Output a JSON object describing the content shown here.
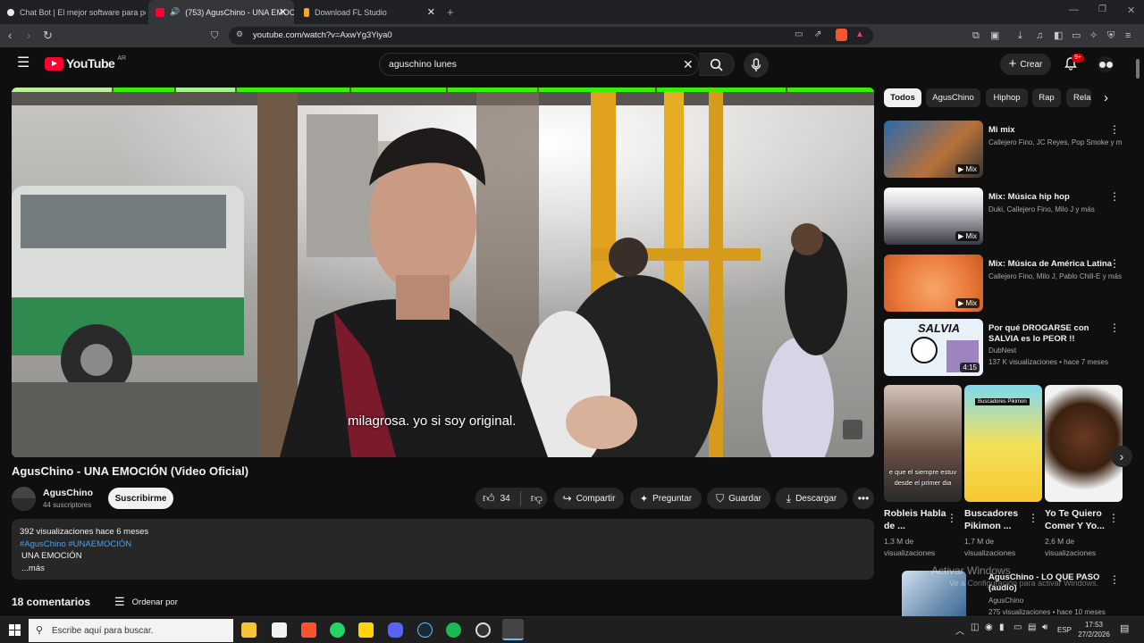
{
  "browser": {
    "tabs": [
      {
        "title": "Chat Bot | El mejor software para pol"
      },
      {
        "title": "(753) AgusChino - UNA EMOC"
      },
      {
        "title": "Download FL Studio"
      }
    ],
    "url": "youtube.com/watch?v=AxwYg3Yiya0"
  },
  "youtube": {
    "logo": "YouTube",
    "country": "AR",
    "search_value": "aguschino lunes",
    "create_label": "Crear",
    "notification_count": "9+"
  },
  "video": {
    "caption": "milagrosa.  yo si soy original.",
    "title": "AgusChino - UNA EMOCIÓN (Video Oficial)",
    "channel": "AgusChino",
    "subscribers": "44 suscriptores",
    "subscribe_label": "Suscribirme",
    "likes": "34",
    "share_label": "Compartir",
    "ask_label": "Preguntar",
    "save_label": "Guardar",
    "download_label": "Descargar",
    "progress_segments_color": "#35f000"
  },
  "description": {
    "stats": "392 visualizaciones  hace 6 meses",
    "hashtags": "#AgusChino  #UNAEMOCIÓN",
    "line1": "UNA EMOCIÓN",
    "more": "...más"
  },
  "comments": {
    "count_label": "18 comentarios",
    "sort_label": "Ordenar por"
  },
  "chips": [
    "Todos",
    "AgusChino",
    "Hiphop",
    "Rap",
    "Rela"
  ],
  "recommendations": [
    {
      "title": "Mi mix",
      "sub1": "Callejero Fino, JC Reyes, Pop Smoke y m...",
      "sub2": "",
      "badge": "Mix"
    },
    {
      "title": "Mix: Música hip hop",
      "sub1": "Duki, Callejero Fino, Milo J y más",
      "sub2": "",
      "badge": "Mix"
    },
    {
      "title": "Mix: Música de América Latina",
      "sub1": "Callejero Fino, Milo J, Pablo Chill-E y más",
      "sub2": "",
      "badge": "Mix"
    },
    {
      "title": "Por qué DROGARSE con SALVIA es lo PEOR !!",
      "sub1": "DubNest",
      "sub2": "137 K visualizaciones  •  hace 7 meses",
      "badge": "4:15"
    }
  ],
  "shorts": [
    {
      "title": "Robleis Habla de ...",
      "views": "1,3 M de visualizaciones"
    },
    {
      "title": "Buscadores Pikimon ...",
      "views": "1,7 M de visualizaciones"
    },
    {
      "title": "Yo Te Quiero Comer Y Yo...",
      "views": "2,6 M de visualizaciones"
    }
  ],
  "shorts_overlay": {
    "text1": "e que el siempre estuv",
    "text2": "desde el primer dia",
    "badge2": "Buscadores Pikimon"
  },
  "last_rec": {
    "title": "AgusChino - LO QUE PASO (audio)",
    "channel": "AgusChino",
    "stats": "275 visualizaciones  •  hace 10 meses"
  },
  "salvia_text": "SALVIA",
  "watermark": {
    "line1": "Activar Windows",
    "line2": "Ve a Configuración para activar Windows."
  },
  "taskbar": {
    "search_placeholder": "Escribe aquí para buscar.",
    "lang": "ESP",
    "time": "17:53",
    "date": "27/2/2026"
  }
}
